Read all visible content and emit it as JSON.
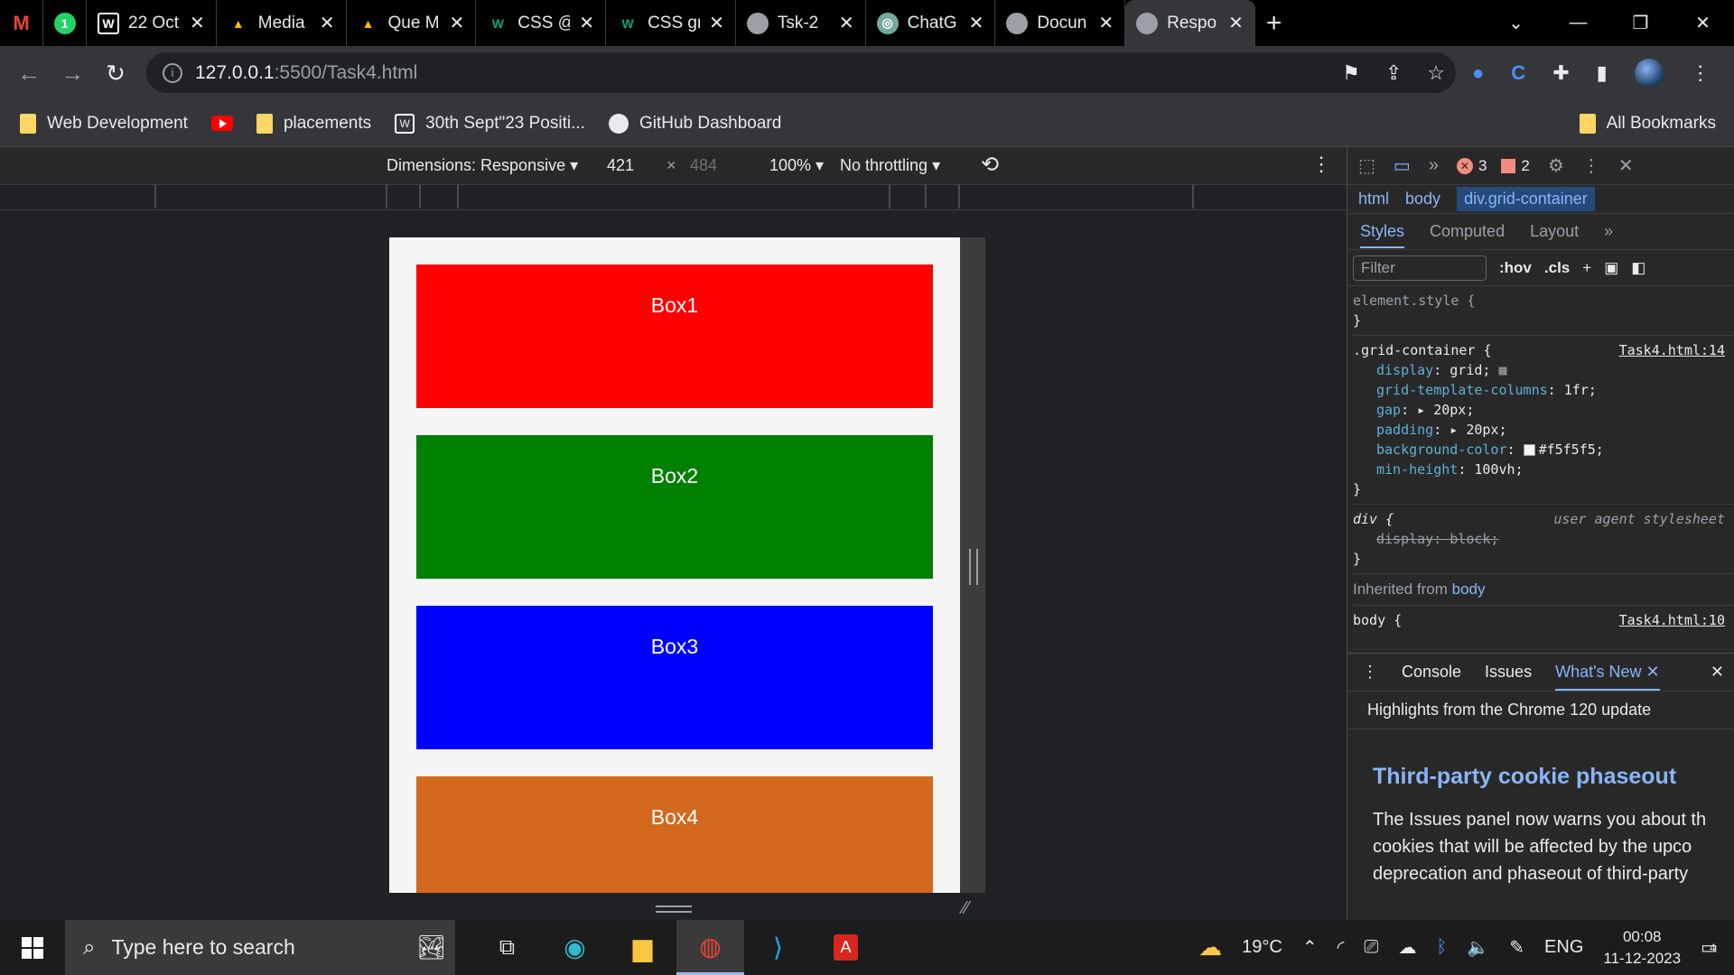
{
  "tabs": [
    {
      "title": "22 Oct",
      "icon": "wordpress-icon",
      "color": "#ffffff"
    },
    {
      "title": "Media",
      "icon": "drive-icon",
      "color": "#fbbc04"
    },
    {
      "title": "Que M",
      "icon": "drive-icon",
      "color": "#fbbc04"
    },
    {
      "title": "CSS @",
      "icon": "w3schools-icon",
      "color": "#04aa6d"
    },
    {
      "title": "CSS gr",
      "icon": "w3schools-icon",
      "color": "#04aa6d"
    },
    {
      "title": "Tsk-2",
      "icon": "globe-icon",
      "color": "#9aa0a6"
    },
    {
      "title": "ChatG",
      "icon": "chatgpt-icon",
      "color": "#74aa9c"
    },
    {
      "title": "Docun",
      "icon": "globe-icon",
      "color": "#9aa0a6"
    },
    {
      "title": "Respo",
      "icon": "globe-icon",
      "color": "#9aa0a6"
    }
  ],
  "address": {
    "host": "127.0.0.1",
    "path": ":5500/Task4.html"
  },
  "bookmarks": [
    {
      "label": "Web Development",
      "icon": "folder"
    },
    {
      "label": "",
      "icon": "youtube"
    },
    {
      "label": "placements",
      "icon": "folder"
    },
    {
      "label": "30th Sept\"23 Positi...",
      "icon": "wordpress"
    },
    {
      "label": "GitHub Dashboard",
      "icon": "github"
    }
  ],
  "all_bookmarks": "All Bookmarks",
  "emulation": {
    "dimensions": "Dimensions: Responsive",
    "width": "421",
    "times": "×",
    "height": "484",
    "zoom": "100%",
    "throttling": "No throttling"
  },
  "page": {
    "boxes": [
      {
        "label": "Box1",
        "color": "#ff0000"
      },
      {
        "label": "Box2",
        "color": "#008000"
      },
      {
        "label": "Box3",
        "color": "#0000ff"
      },
      {
        "label": "Box4",
        "color": "#d2691e"
      }
    ]
  },
  "devtools": {
    "error_count": "3",
    "warning_count": "2",
    "breadcrumbs": [
      "html",
      "body",
      "div.grid-container"
    ],
    "subtabs": [
      "Styles",
      "Computed",
      "Layout"
    ],
    "filter_placeholder": "Filter",
    "hov": ":hov",
    "cls": ".cls",
    "element_style": "element.style {",
    "close_brace": "}",
    "grid_selector": ".grid-container {",
    "grid_source": "Task4.html:14",
    "grid_props": [
      {
        "name": "display",
        "value": "grid;"
      },
      {
        "name": "grid-template-columns",
        "value": "1fr;"
      },
      {
        "name": "gap",
        "value": "20px;"
      },
      {
        "name": "padding",
        "value": "20px;"
      },
      {
        "name": "background-color",
        "value": "#f5f5f5;"
      },
      {
        "name": "min-height",
        "value": "100vh;"
      }
    ],
    "div_selector": "div {",
    "ua_label": "user agent stylesheet",
    "div_prop": "display: block;",
    "inherited_label": "Inherited from",
    "inherited_from": "body",
    "body_selector": "body {",
    "body_source": "Task4.html:10",
    "drawer_tabs": [
      "Console",
      "Issues",
      "What's New"
    ],
    "whatsnew_header": "Highlights from the Chrome 120 update",
    "whatsnew_title": "Third-party cookie phaseout",
    "whatsnew_lines": [
      "The Issues panel now warns you about th",
      "cookies that will be affected by the upco",
      "deprecation and phaseout of third-party"
    ]
  },
  "taskbar": {
    "search_placeholder": "Type here to search",
    "weather": "19°C",
    "lang": "ENG",
    "time": "00:08",
    "date": "11-12-2023",
    "notifications": "4"
  }
}
